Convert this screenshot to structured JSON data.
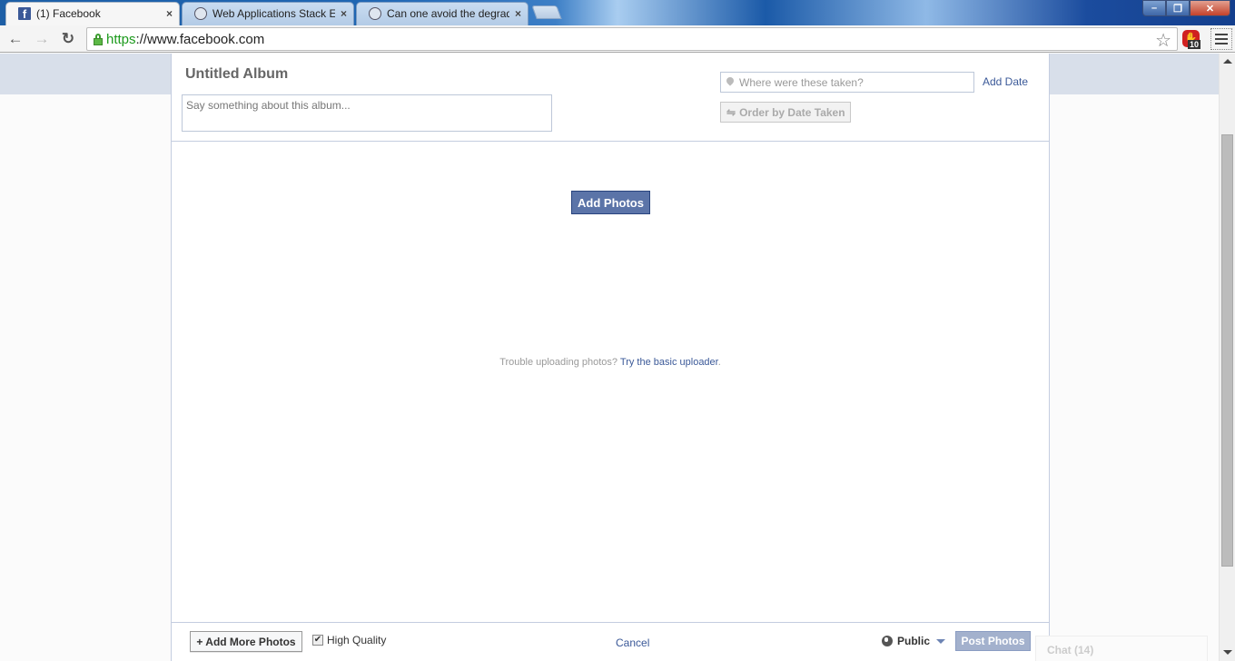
{
  "browser": {
    "tabs": [
      {
        "title": "(1) Facebook",
        "icon": "facebook-icon",
        "active": true
      },
      {
        "title": "Web Applications Stack Ex",
        "icon": "cloud-icon",
        "active": false
      },
      {
        "title": "Can one avoid the degrad",
        "icon": "cloud-icon",
        "active": false
      }
    ],
    "close_glyph": "×",
    "window_controls": {
      "minimize": "–",
      "maximize": "❐",
      "close": "✕"
    },
    "url_scheme": "https",
    "url_rest": "://www.facebook.com",
    "nav": {
      "back": "←",
      "forward": "→",
      "reload": "↻"
    },
    "star": "☆",
    "extension_badge": "10"
  },
  "album": {
    "title": "Untitled Album",
    "description_placeholder": "Say something about this album...",
    "location_placeholder": "Where were these taken?",
    "add_date": "Add Date",
    "order_button": "Order by Date Taken",
    "order_icon": "⇋"
  },
  "upload": {
    "add_photos": "Add Photos",
    "trouble_text": "Trouble uploading photos?",
    "basic_uploader_link": "Try the basic uploader",
    "trailing": "."
  },
  "footer": {
    "add_more": "+ Add More Photos",
    "high_quality": "High Quality",
    "high_quality_checked": true,
    "check_glyph": "✔",
    "cancel": "Cancel",
    "privacy": "Public",
    "post": "Post Photos"
  },
  "chat": {
    "label": "Chat (14)"
  },
  "colors": {
    "facebook_blue": "#3b5998",
    "button_blue": "#5b74a8",
    "disabled_blue": "#a3b1cd"
  }
}
